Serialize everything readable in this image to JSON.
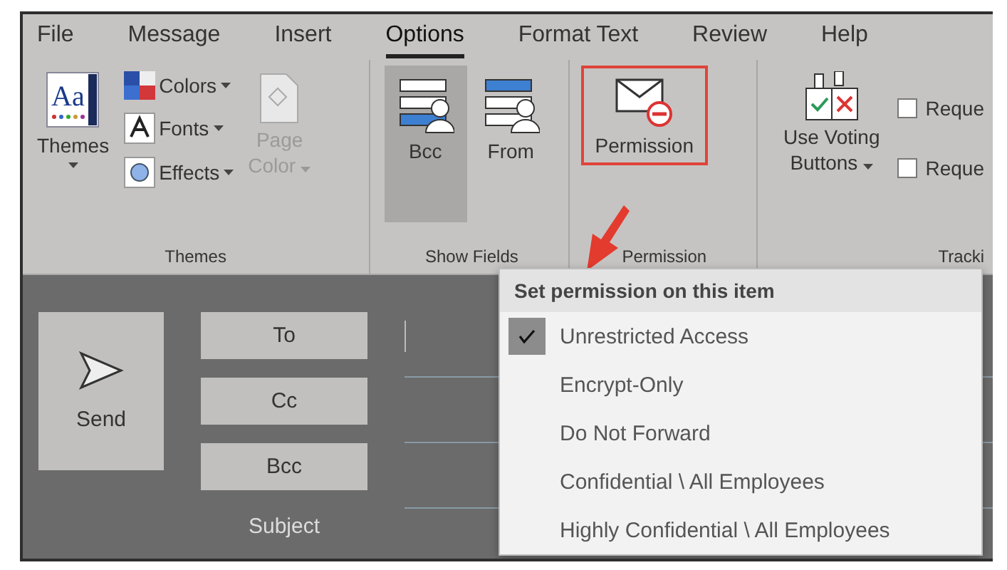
{
  "tabs": [
    {
      "label": "File",
      "selected": false
    },
    {
      "label": "Message",
      "selected": false
    },
    {
      "label": "Insert",
      "selected": false
    },
    {
      "label": "Options",
      "selected": true
    },
    {
      "label": "Format Text",
      "selected": false
    },
    {
      "label": "Review",
      "selected": false
    },
    {
      "label": "Help",
      "selected": false
    }
  ],
  "ribbon": {
    "themes_group": {
      "label": "Themes",
      "themes_button": "Themes",
      "themes_icon_text": "Aa",
      "colors_button": "Colors",
      "fonts_button": "Fonts",
      "effects_button": "Effects",
      "page_color_button": {
        "label_line_1": "Page",
        "label_line_2": "Color",
        "disabled": true
      }
    },
    "show_fields_group": {
      "label": "Show Fields",
      "buttons": [
        {
          "label": "Bcc",
          "selected": true
        },
        {
          "label": "From",
          "selected": false
        }
      ]
    },
    "permission_group": {
      "label": "Permission",
      "button": "Permission",
      "highlighted": true
    },
    "tracking_group": {
      "label": "Tracki",
      "voting_button": {
        "label_line_1": "Use Voting",
        "label_line_2": "Buttons"
      },
      "checkboxes": [
        {
          "label": "Reque",
          "checked": false
        },
        {
          "label": "Reque",
          "checked": false
        }
      ]
    }
  },
  "compose": {
    "send_button": "Send",
    "field_buttons": [
      "To",
      "Cc",
      "Bcc"
    ],
    "subject_label": "Subject"
  },
  "permission_menu": {
    "header": "Set permission on this item",
    "items": [
      {
        "label": "Unrestricted Access",
        "checked": true
      },
      {
        "label": "Encrypt-Only",
        "checked": false
      },
      {
        "label": "Do Not Forward",
        "checked": false
      },
      {
        "label": "Confidential \\ All Employees",
        "checked": false
      },
      {
        "label": "Highly Confidential \\ All Employees",
        "checked": false
      }
    ]
  }
}
